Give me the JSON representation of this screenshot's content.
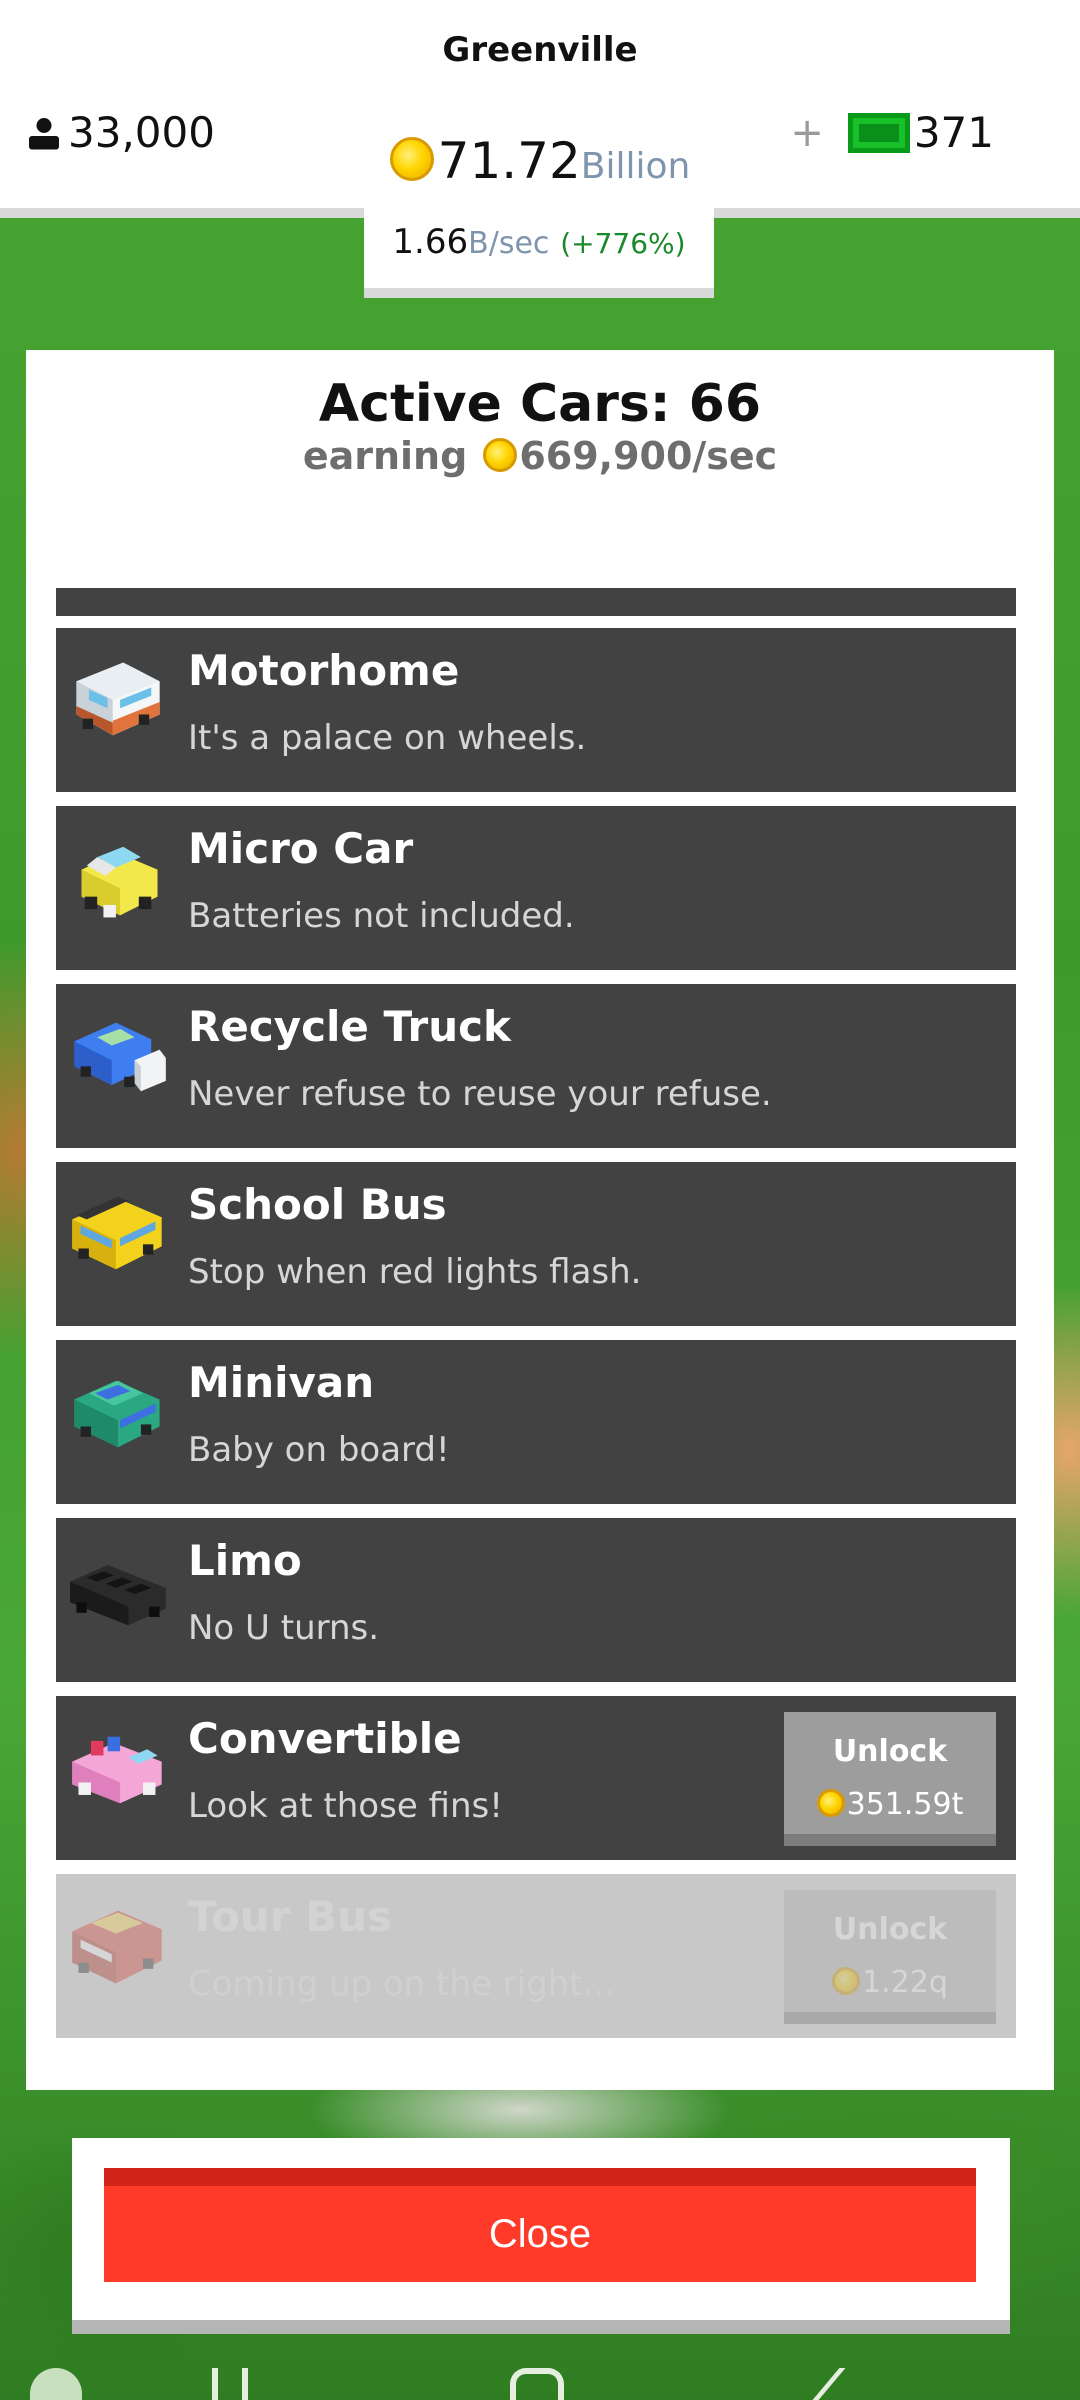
{
  "hud": {
    "city": "Greenville",
    "population": "33,000",
    "cash_value": "71.72",
    "cash_unit": "Billion",
    "plus": "+",
    "bucks": "371",
    "rate_value": "1.66",
    "rate_unit": "B/sec",
    "rate_change": "(+776%)"
  },
  "panel": {
    "title": "Active Cars: 66",
    "earning_label": "earning",
    "earning_value": "669,900/sec"
  },
  "cars": [
    {
      "name": "Motorhome",
      "desc": "It's a palace on wheels."
    },
    {
      "name": "Micro Car",
      "desc": "Batteries not included."
    },
    {
      "name": "Recycle Truck",
      "desc": "Never refuse to reuse your refuse."
    },
    {
      "name": "School Bus",
      "desc": "Stop when red lights flash."
    },
    {
      "name": "Minivan",
      "desc": "Baby on board!"
    },
    {
      "name": "Limo",
      "desc": "No U turns."
    },
    {
      "name": "Convertible",
      "desc": "Look at those fins!",
      "unlock_label": "Unlock",
      "price": "351.59t"
    },
    {
      "name": "Tour Bus",
      "desc": "Coming up on the right...",
      "unlock_label": "Unlock",
      "price": "1.22q"
    }
  ],
  "close_label": "Close",
  "colors": {
    "row_bg": "#424242",
    "close_red": "#ff3a29",
    "cash_green": "#18c12a",
    "coin_gold": "#ffd500"
  }
}
